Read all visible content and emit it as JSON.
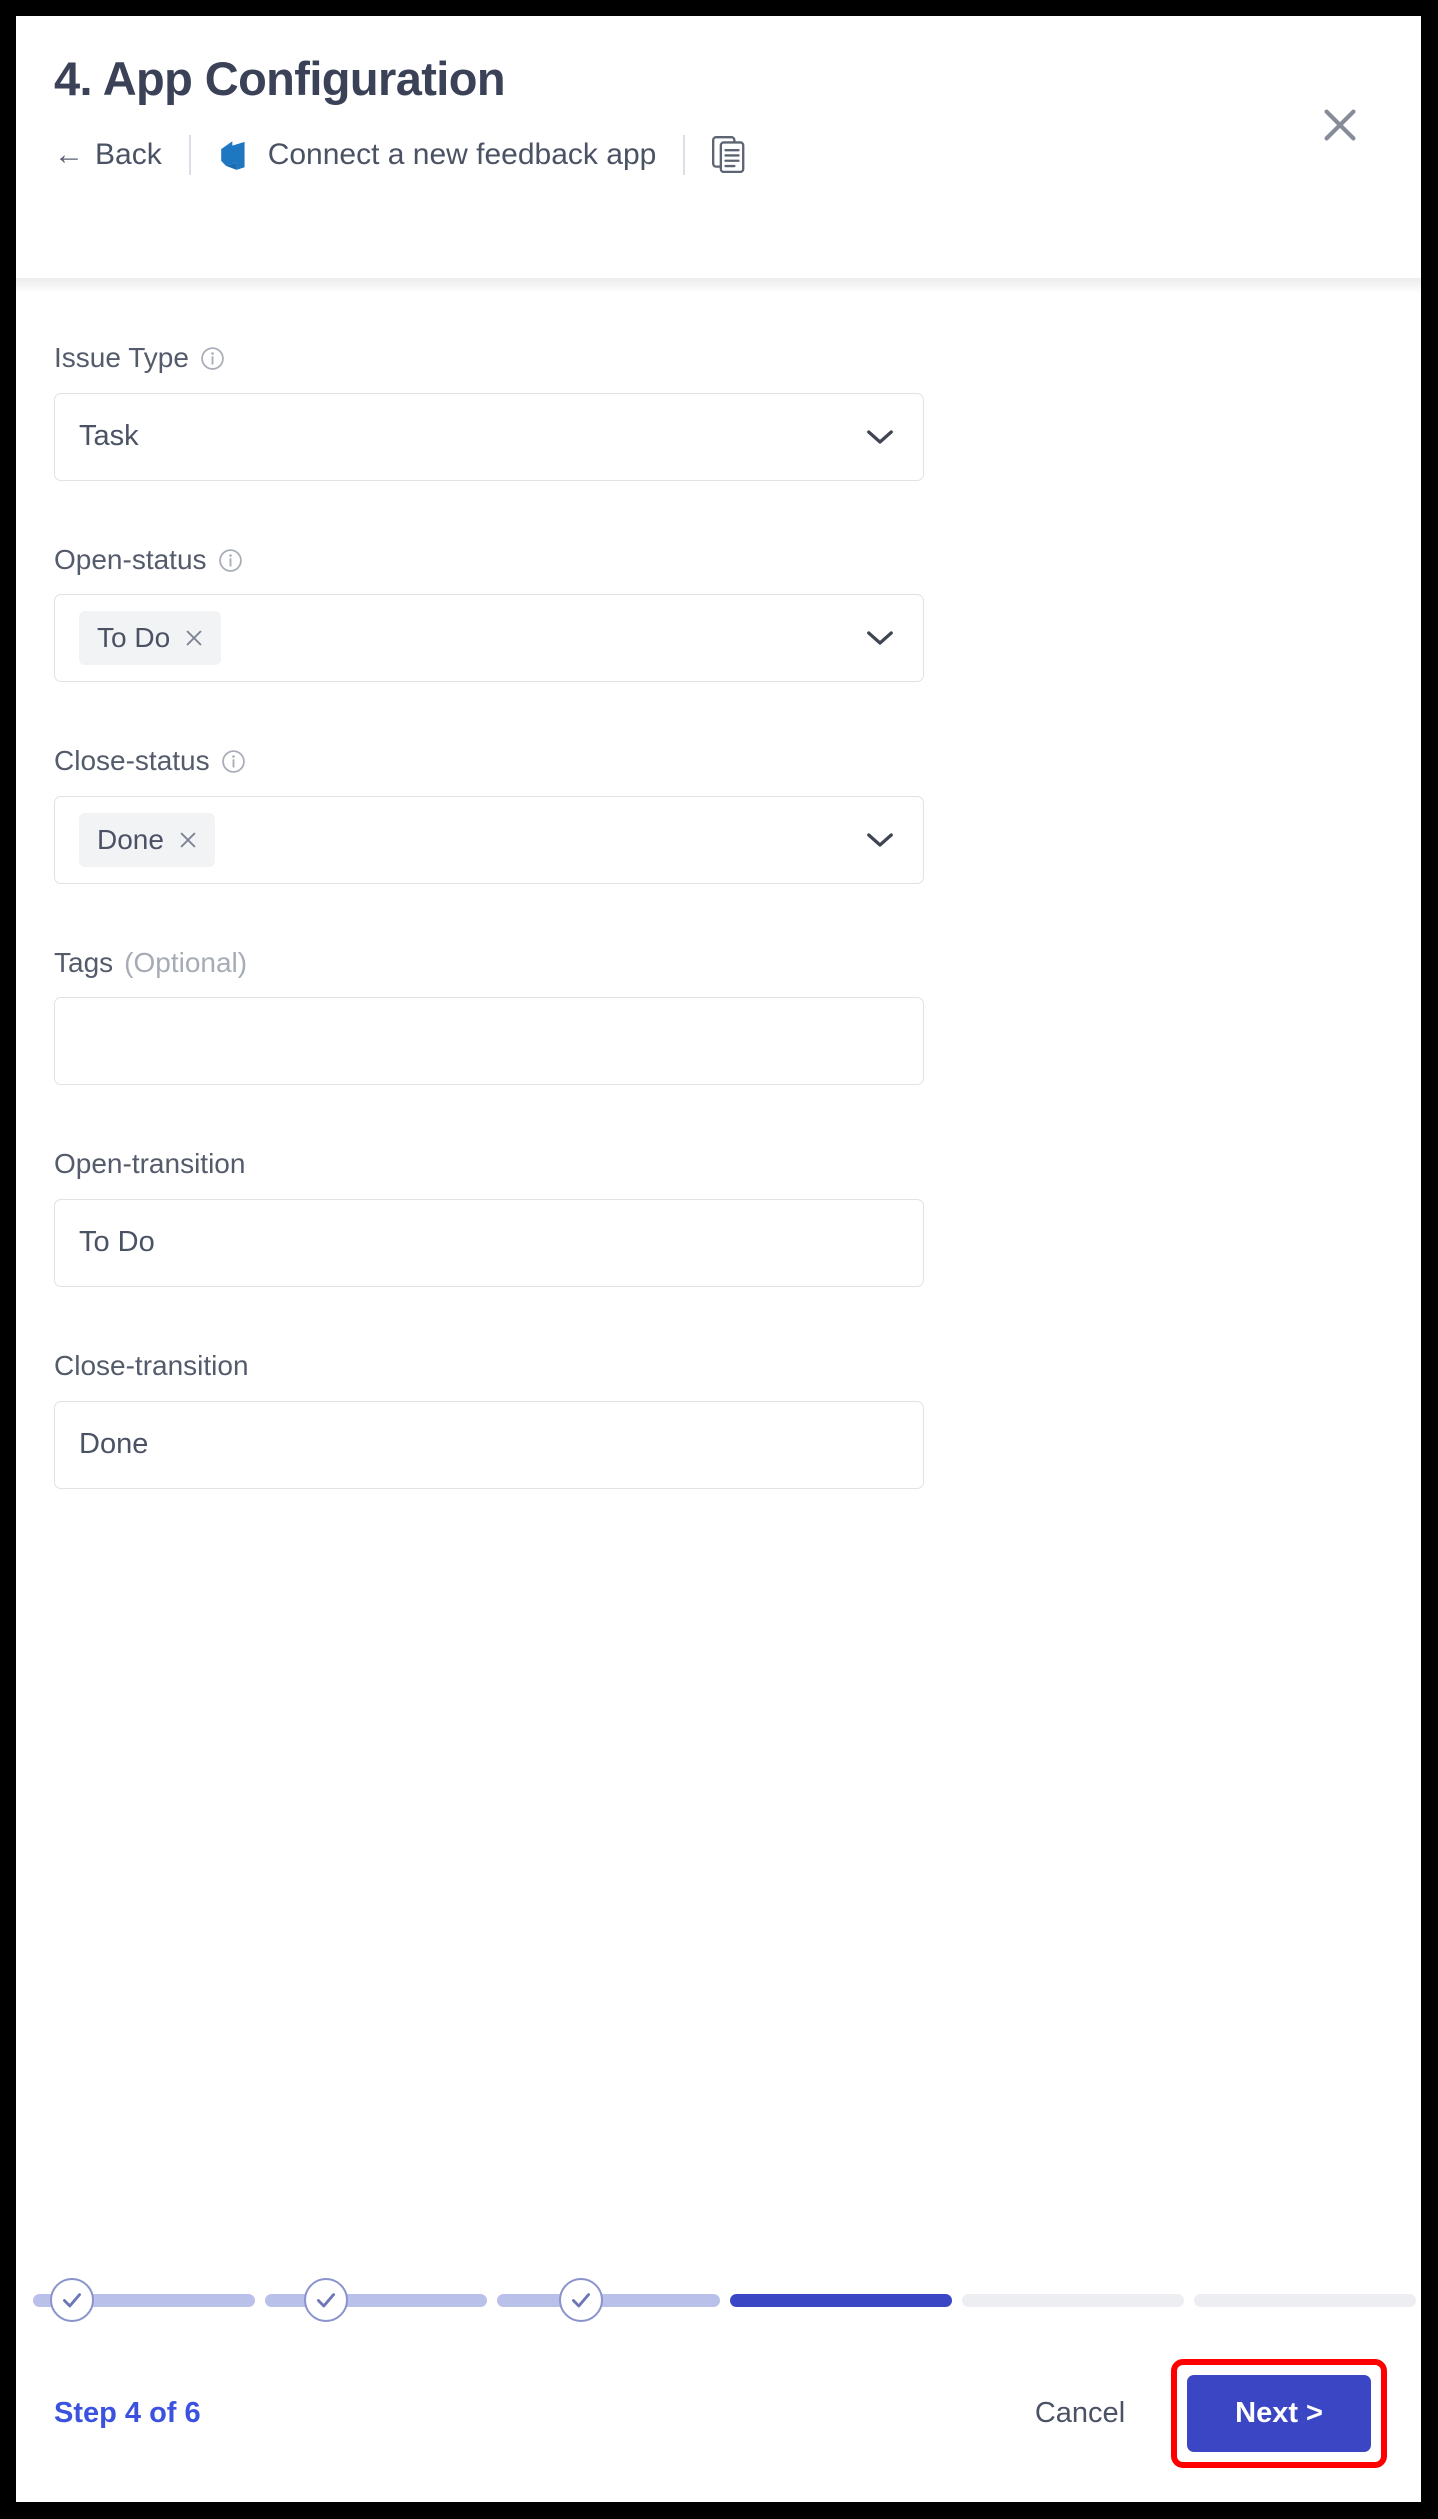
{
  "header": {
    "title": "4. App Configuration",
    "back_label": "Back",
    "back_arrow": "←",
    "app_label": "Connect a new feedback app",
    "azure_icon": "azure-devops-icon",
    "doc_icon": "document-copy-icon",
    "close_icon": "close-icon"
  },
  "form": {
    "fields": [
      {
        "label": "Issue Type",
        "has_info": true,
        "type": "select",
        "value": "Task",
        "name": "issue-type"
      },
      {
        "label": "Open-status",
        "has_info": true,
        "type": "multiselect",
        "chip": "To Do",
        "name": "open-status"
      },
      {
        "label": "Close-status",
        "has_info": true,
        "type": "multiselect",
        "chip": "Done",
        "name": "close-status"
      },
      {
        "label": "Tags",
        "optional_suffix": "(Optional)",
        "has_info": false,
        "type": "text",
        "value": "",
        "placeholder": "",
        "name": "tags"
      },
      {
        "label": "Open-transition",
        "has_info": false,
        "type": "text",
        "value": "To Do",
        "name": "open-transition"
      },
      {
        "label": "Close-transition",
        "has_info": false,
        "type": "text",
        "value": "Done",
        "name": "close-transition"
      }
    ]
  },
  "footer": {
    "step_label": "Step 4 of 6",
    "cancel_label": "Cancel",
    "next_label": "Next >",
    "current_step": 4,
    "total_steps": 6,
    "segments": [
      "done",
      "done",
      "done",
      "active",
      "todo",
      "todo"
    ]
  },
  "colors": {
    "primary": "#3b46c4",
    "step_text": "#3b52e0",
    "done_segment": "#b9c0ea",
    "todo_segment": "#eceef1",
    "border": "#e0e2e7",
    "label_text": "#545b6b",
    "title_text": "#3b4257",
    "highlight_box": "#ff0000",
    "azure_blue": "#1f77c1"
  }
}
